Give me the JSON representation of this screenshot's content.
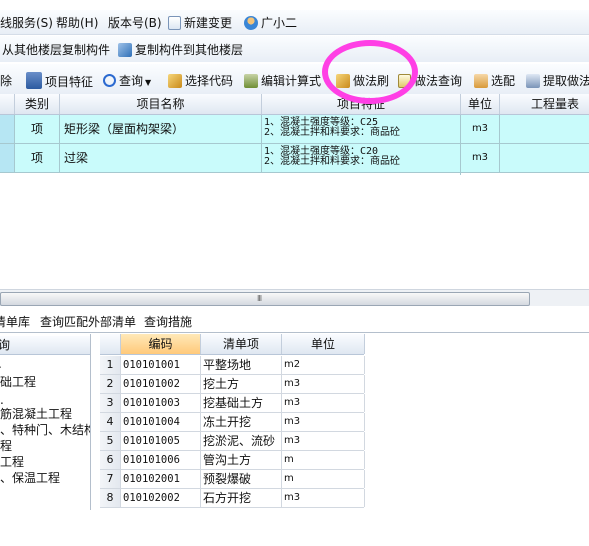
{
  "menubar": {
    "items": [
      "线服务(S)",
      "帮助(H)",
      "版本号(B)",
      "新建变更",
      "广小二"
    ]
  },
  "toolbar1": {
    "copy_from": "从其他楼层复制构件",
    "copy_to": "复制构件到其他楼层"
  },
  "toolbar2": {
    "delete": "除",
    "item_feature": "项目特征",
    "query": "查询",
    "select_code": "选择代码",
    "edit_formula": "编辑计算式",
    "method_brush": "做法刷",
    "method_query": "做法查询",
    "pick": "选配",
    "extract": "提取做法"
  },
  "grid": {
    "headers": [
      "类别",
      "项目名称",
      "项目特征",
      "单位",
      "工程量表"
    ],
    "rows": [
      {
        "category": "项",
        "name": "矩形梁（屋面构架梁）",
        "feat1": "1、混凝土强度等级：C25",
        "feat2": "2、混凝土拌和料要求：商品砼",
        "unit": "m3"
      },
      {
        "category": "项",
        "name": "过梁",
        "feat1": "1、混凝土强度等级：C20",
        "feat2": "2、混凝土拌和料要求：商品砼",
        "unit": "m3"
      }
    ]
  },
  "scrollbar": {
    "grip": "III"
  },
  "bottom": {
    "tabs": [
      "清单库",
      "查询匹配外部清单",
      "查询措施"
    ],
    "tree_header": "询",
    "tree_items": [
      "础工程",
      "筋混凝土工程",
      "、特种门、木结构",
      "程",
      "工程",
      "、保温工程"
    ],
    "list_headers": [
      "编码",
      "清单项",
      "单位"
    ],
    "list_rows": [
      {
        "n": "1",
        "code": "010101001",
        "name": "平整场地",
        "unit": "m2"
      },
      {
        "n": "2",
        "code": "010101002",
        "name": "挖土方",
        "unit": "m3"
      },
      {
        "n": "3",
        "code": "010101003",
        "name": "挖基础土方",
        "unit": "m3"
      },
      {
        "n": "4",
        "code": "010101004",
        "name": "冻土开挖",
        "unit": "m3"
      },
      {
        "n": "5",
        "code": "010101005",
        "name": "挖淤泥、流砂",
        "unit": "m3"
      },
      {
        "n": "6",
        "code": "010101006",
        "name": "管沟土方",
        "unit": "m"
      },
      {
        "n": "7",
        "code": "010102001",
        "name": "预裂爆破",
        "unit": "m"
      },
      {
        "n": "8",
        "code": "010102002",
        "name": "石方开挖",
        "unit": "m3"
      }
    ]
  },
  "colors": {
    "row_highlight": "#c9fbfb",
    "annotation_circle": "#ff3fe5",
    "selected_header": "#ffc97a"
  }
}
